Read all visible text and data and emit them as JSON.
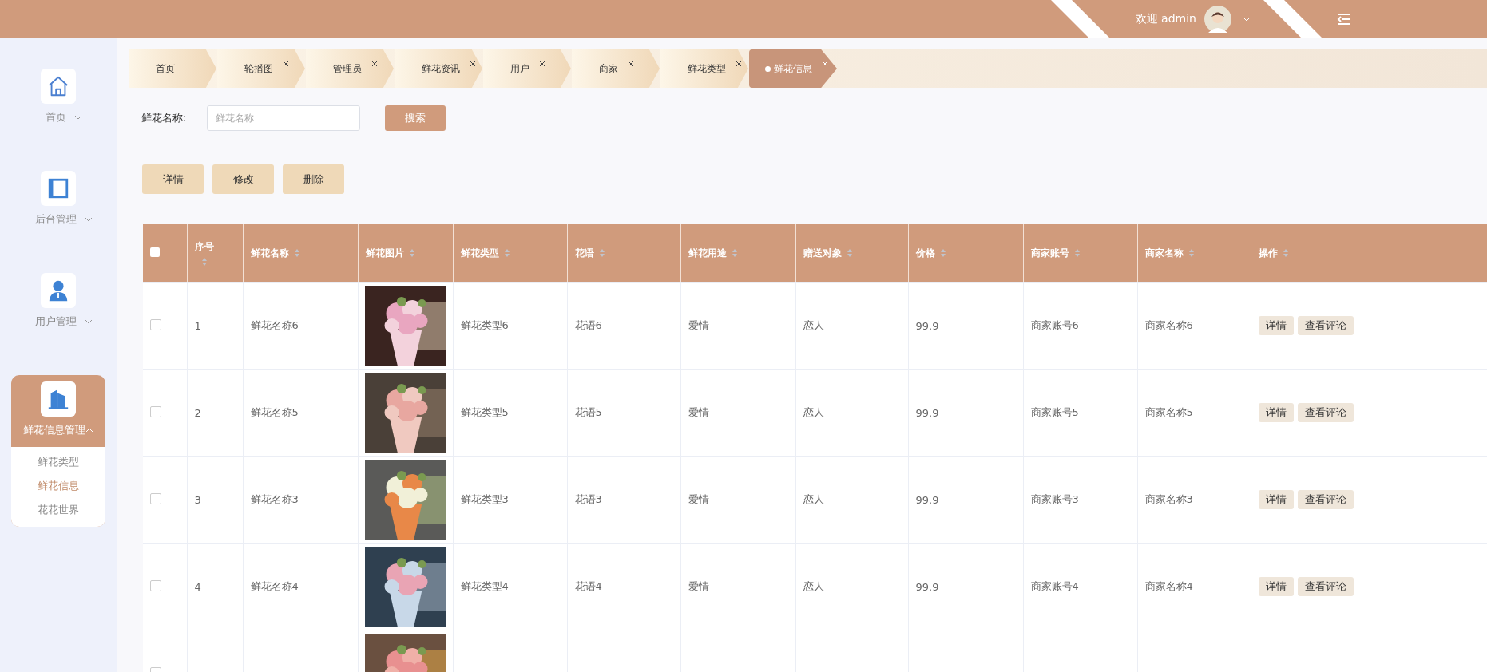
{
  "header": {
    "welcome": "欢迎 admin"
  },
  "sidebar": {
    "items": [
      {
        "label": "首页",
        "expanded": false,
        "selected": false
      },
      {
        "label": "后台管理",
        "expanded": false,
        "selected": false
      },
      {
        "label": "用户管理",
        "expanded": false,
        "selected": false
      },
      {
        "label": "鲜花信息管理",
        "expanded": true,
        "selected": true,
        "children": [
          {
            "label": "鲜花类型",
            "selected": false
          },
          {
            "label": "鲜花信息",
            "selected": true
          },
          {
            "label": "花花世界",
            "selected": false
          }
        ]
      }
    ]
  },
  "tabs": [
    {
      "label": "首页",
      "closable": false,
      "selected": false
    },
    {
      "label": "轮播图",
      "closable": true,
      "selected": false
    },
    {
      "label": "管理员",
      "closable": true,
      "selected": false
    },
    {
      "label": "鲜花资讯",
      "closable": true,
      "selected": false
    },
    {
      "label": "用户",
      "closable": true,
      "selected": false
    },
    {
      "label": "商家",
      "closable": true,
      "selected": false
    },
    {
      "label": "鲜花类型",
      "closable": true,
      "selected": false
    },
    {
      "label": "鲜花信息",
      "closable": true,
      "selected": true
    }
  ],
  "search": {
    "label": "鲜花名称:",
    "placeholder": "鲜花名称",
    "button": "搜索"
  },
  "actions": [
    "详情",
    "修改",
    "删除"
  ],
  "table": {
    "all_checked": false,
    "columns": [
      "序号",
      "鲜花名称",
      "鲜花图片",
      "鲜花类型",
      "花语",
      "鲜花用途",
      "赠送对象",
      "价格",
      "商家账号",
      "商家名称",
      "操作"
    ],
    "rows": [
      {
        "checked": false,
        "cells": [
          "1",
          "鲜花名称6",
          {
            "kind": "picture"
          },
          "鲜花类型6",
          "花语6",
          "爱情",
          "恋人",
          "99.9",
          "商家账号6",
          "商家名称6"
        ],
        "buttons": [
          "详情",
          "查看评论"
        ]
      },
      {
        "checked": false,
        "cells": [
          "2",
          "鲜花名称5",
          {
            "kind": "picture"
          },
          "鲜花类型5",
          "花语5",
          "爱情",
          "恋人",
          "99.9",
          "商家账号5",
          "商家名称5"
        ],
        "buttons": [
          "详情",
          "查看评论"
        ]
      },
      {
        "checked": false,
        "cells": [
          "3",
          "鲜花名称3",
          {
            "kind": "picture"
          },
          "鲜花类型3",
          "花语3",
          "爱情",
          "恋人",
          "99.9",
          "商家账号3",
          "商家名称3"
        ],
        "buttons": [
          "详情",
          "查看评论"
        ]
      },
      {
        "checked": false,
        "cells": [
          "4",
          "鲜花名称4",
          {
            "kind": "picture"
          },
          "鲜花类型4",
          "花语4",
          "爱情",
          "恋人",
          "99.9",
          "商家账号4",
          "商家名称4"
        ],
        "buttons": [
          "详情",
          "查看评论"
        ]
      },
      {
        "checked": false,
        "cells": [
          "",
          "",
          {
            "kind": "picture"
          },
          "",
          "",
          "",
          "",
          "",
          "",
          ""
        ],
        "buttons": []
      }
    ]
  }
}
